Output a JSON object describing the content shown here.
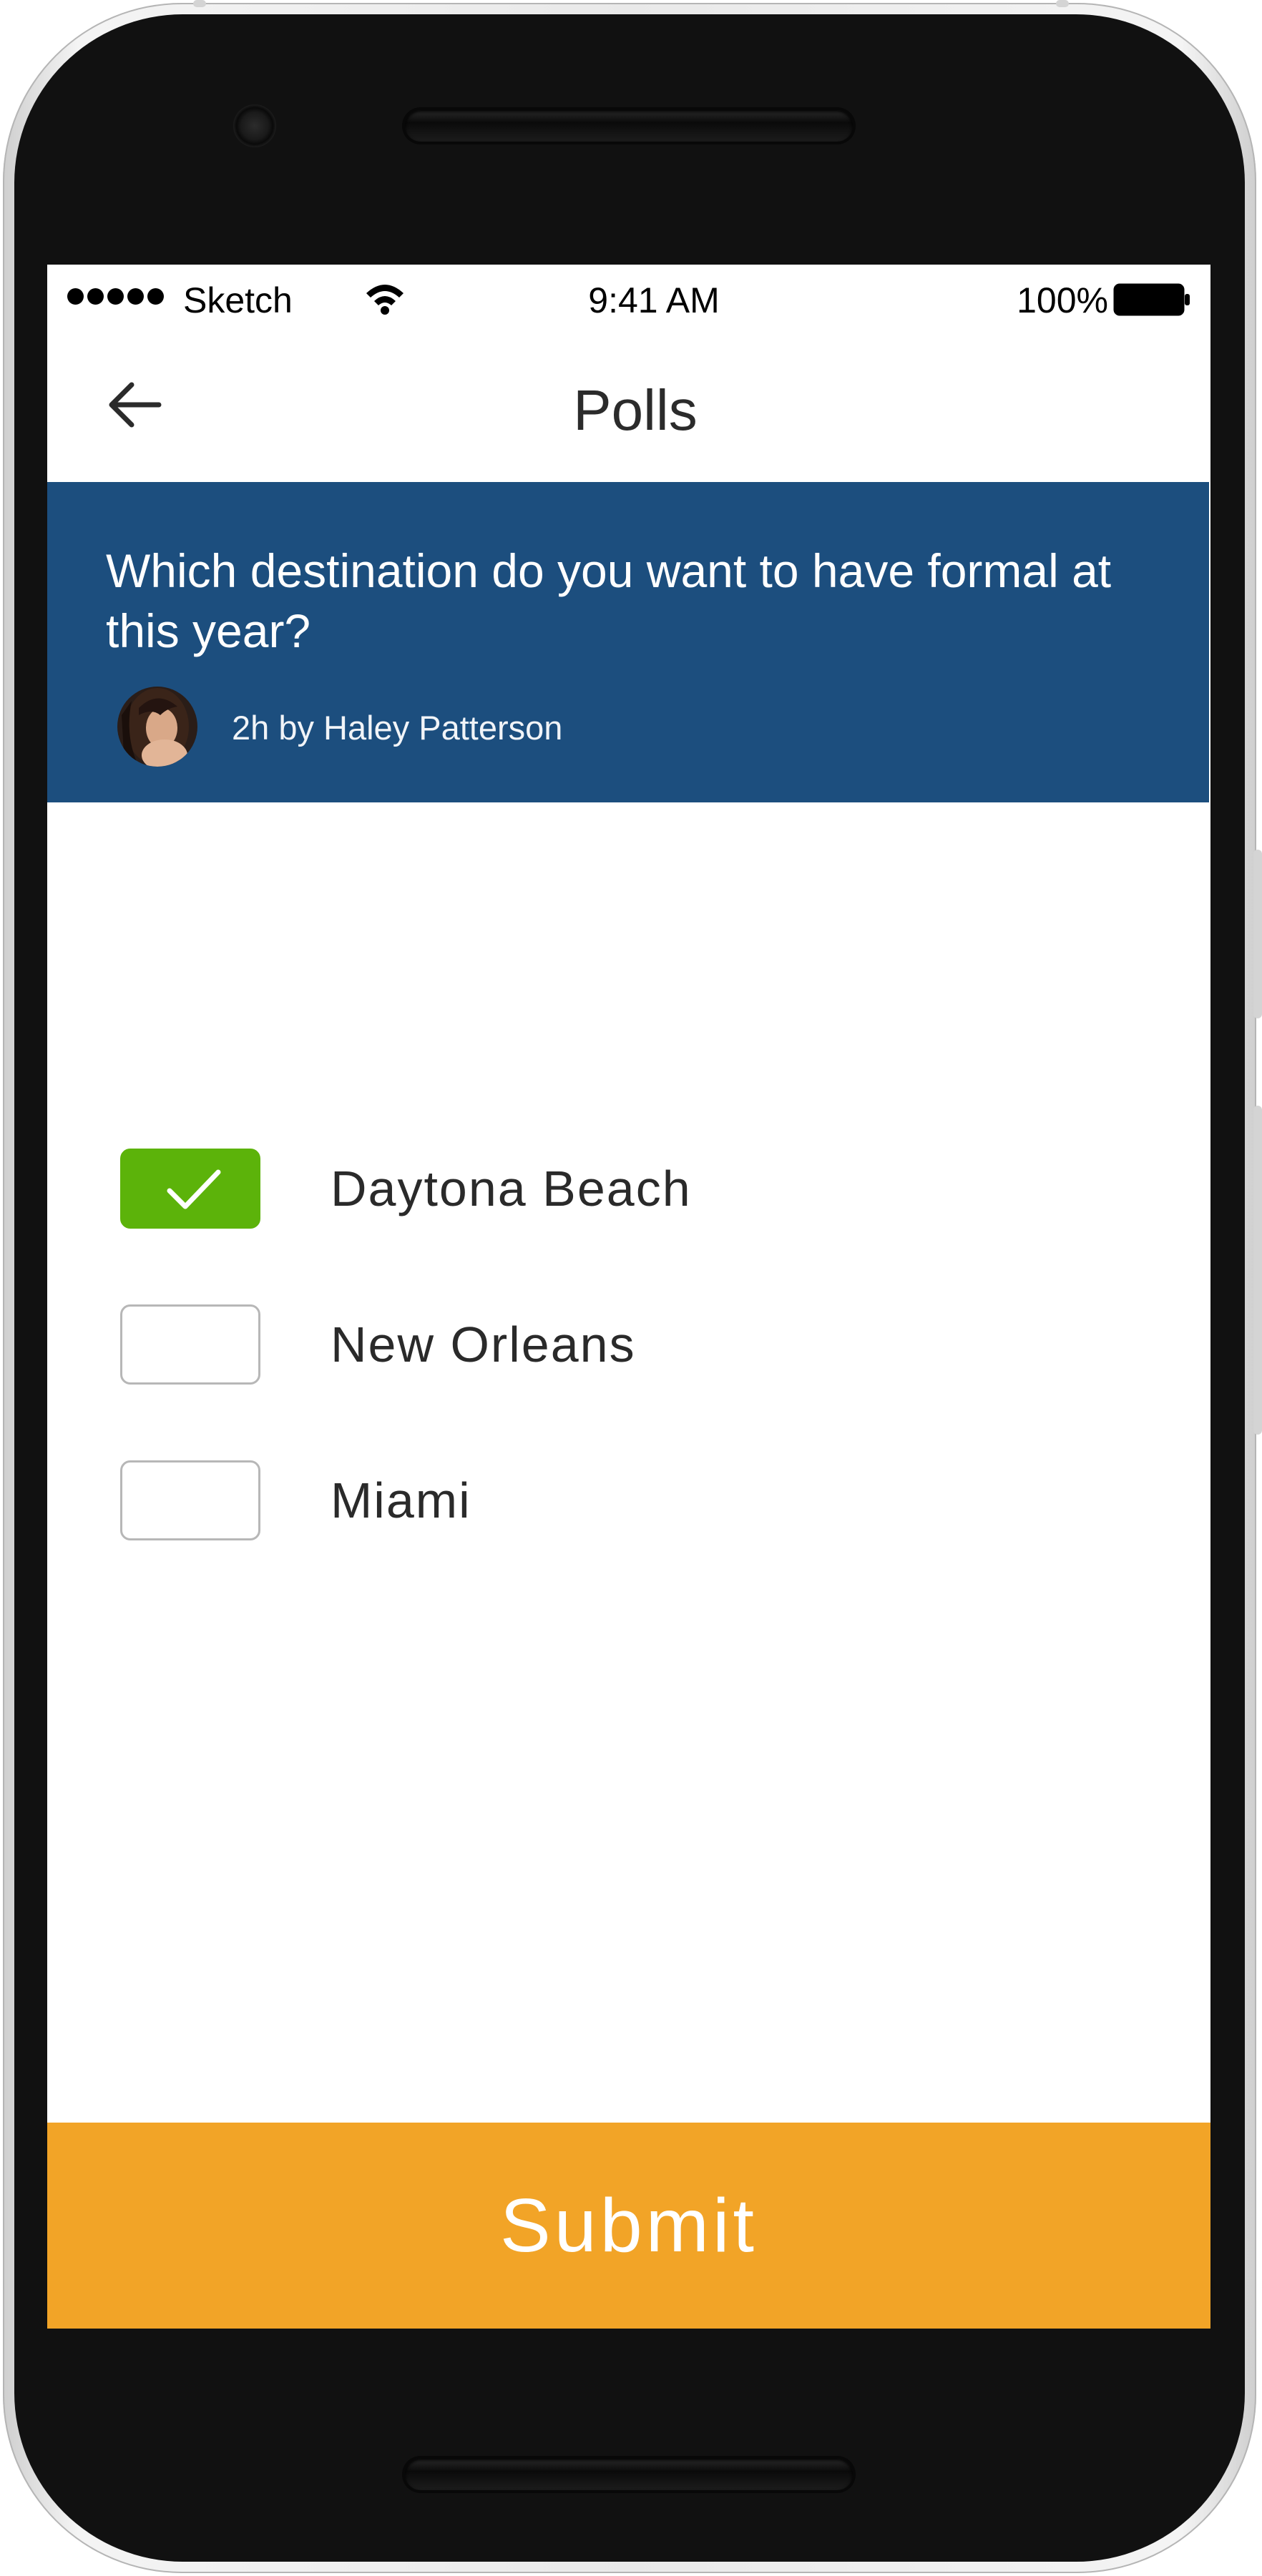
{
  "status_bar": {
    "carrier": "Sketch",
    "time": "9:41 AM",
    "battery": "100%",
    "icons": [
      "signal-dots-icon",
      "wifi-icon",
      "battery-icon"
    ]
  },
  "nav": {
    "back_icon": "arrow-left-icon",
    "title": "Polls"
  },
  "poll": {
    "question": "Which destination do you want to have formal at this year?",
    "meta": "2h by Haley Patterson",
    "avatar_icon": "user-avatar",
    "options": [
      {
        "label": "Daytona Beach",
        "checked": true
      },
      {
        "label": "New Orleans",
        "checked": false
      },
      {
        "label": "Miami",
        "checked": false
      }
    ]
  },
  "submit": {
    "label": "Submit"
  },
  "colors": {
    "banner": "#1c4e7e",
    "checked": "#5cb30a",
    "submit": "#f2a427"
  }
}
